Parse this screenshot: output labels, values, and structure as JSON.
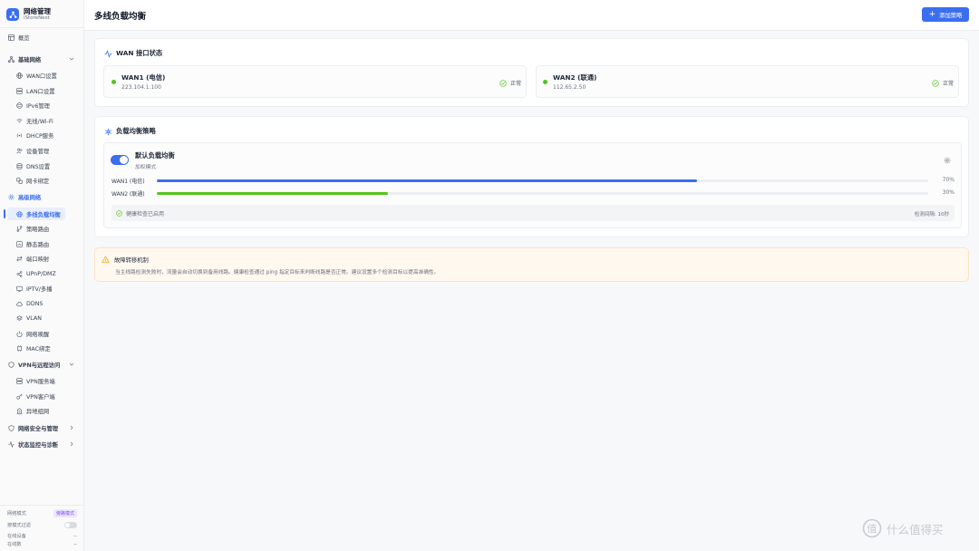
{
  "brand": {
    "title": "网络管理",
    "subtitle": "iStoreNext"
  },
  "nav": {
    "overview": "概览",
    "basic": "基础网络",
    "basic_items": [
      "WAN口设置",
      "LAN口设置",
      "IPv6管理",
      "无线/Wi-Fi",
      "DHCP服务",
      "设备管理",
      "DNS设置",
      "网卡绑定"
    ],
    "advanced": "高级网络",
    "advanced_items": [
      "多线负载均衡",
      "策略路由",
      "静态路由",
      "端口映射",
      "UPnP/DMZ",
      "IPTV/多播",
      "DDNS",
      "VLAN",
      "网络唤醒",
      "MAC绑定"
    ],
    "vpn": "VPN与远程访问",
    "vpn_items": [
      "VPN服务端",
      "VPN客户端",
      "异地组网"
    ],
    "security": "网络安全与管理",
    "monitor": "状态监控与诊断"
  },
  "sidebar_footer": {
    "mode_label": "网络模式",
    "mode_value": "旁路模式",
    "filter_label": "按模式过滤",
    "online_label": "在线设备",
    "online_value": "--",
    "rate_label": "在线数",
    "rate_value": "--"
  },
  "header": {
    "title": "多线负载均衡",
    "add_button": "添加策略"
  },
  "wan_section": {
    "title": "WAN 接口状态",
    "interfaces": [
      {
        "name": "WAN1 (电信)",
        "ip": "223.104.1.100",
        "status": "正常"
      },
      {
        "name": "WAN2 (联通)",
        "ip": "112.65.2.50",
        "status": "正常"
      }
    ]
  },
  "policy_section": {
    "title": "负载均衡策略",
    "policy": {
      "name": "默认负载均衡",
      "mode": "加权模式",
      "enabled": true,
      "weights": [
        {
          "label": "WAN1 (电信)",
          "percent": 70,
          "pct_text": "70%",
          "color": "#3b6ff0"
        },
        {
          "label": "WAN2 (联通)",
          "percent": 30,
          "pct_text": "30%",
          "color": "#52c41a"
        }
      ],
      "health_text": "健康检查已启用",
      "health_interval": "检测间隔: 10秒"
    }
  },
  "failover": {
    "title": "故障转移机制",
    "text": "当主线路检测失败时，流量会自动切换到备用线路。健康检查通过 ping 指定目标来判断线路是否正常。建议设置多个检测目标以提高准确性。"
  },
  "watermark": "什么值得买",
  "colors": {
    "accent": "#3b6ff0",
    "success": "#52c41a",
    "warning": "#f5a623"
  }
}
